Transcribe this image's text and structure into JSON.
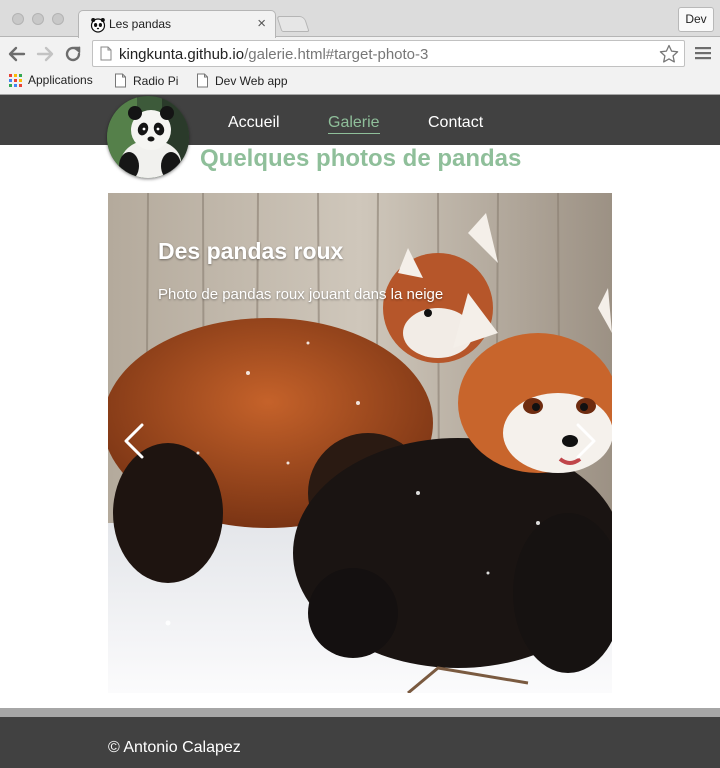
{
  "browser": {
    "tab_title": "Les pandas",
    "tab_close": "×",
    "profile_button": "Dev",
    "url_host": "kingkunta.github.io",
    "url_path": "/galerie.html#target-photo-3",
    "bookmarks": [
      {
        "label": "Applications",
        "icon": "apps-grid-icon"
      },
      {
        "label": "Radio Pi",
        "icon": "page-icon"
      },
      {
        "label": "Dev Web app",
        "icon": "page-icon"
      }
    ]
  },
  "site": {
    "nav": [
      {
        "label": "Accueil",
        "active": false
      },
      {
        "label": "Galerie",
        "active": true
      },
      {
        "label": "Contact",
        "active": false
      }
    ],
    "page_title": "Quelques photos de pandas",
    "accent_color": "#8fbf9a",
    "header_color": "#414141"
  },
  "carousel": {
    "slide_title": "Des pandas roux",
    "slide_caption": "Photo de pandas roux jouant dans la neige",
    "prev_icon": "chevron-left-icon",
    "next_icon": "chevron-right-icon"
  },
  "footer": {
    "text": "© Antonio Calapez"
  }
}
